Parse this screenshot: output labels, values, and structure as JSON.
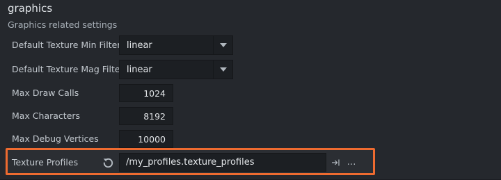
{
  "section": {
    "title": "graphics",
    "description": "Graphics related settings"
  },
  "settings": {
    "min_filter": {
      "label": "Default Texture Min Filter",
      "value": "linear"
    },
    "mag_filter": {
      "label": "Default Texture Mag Filter",
      "value": "linear"
    },
    "max_draw_calls": {
      "label": "Max Draw Calls",
      "value": "1024"
    },
    "max_characters": {
      "label": "Max Characters",
      "value": "8192"
    },
    "max_debug_vertices": {
      "label": "Max Debug Vertices",
      "value": "10000"
    },
    "texture_profiles": {
      "label": "Texture Profiles",
      "value": "/my_profiles.texture_profiles",
      "more_label": "…"
    }
  },
  "colors": {
    "highlight": "#ee6b30",
    "background": "#25282d",
    "field": "#1c1f23"
  },
  "icons": {
    "dropdown": "chevron-down-icon",
    "reset": "reset-icon",
    "jump": "jump-to-icon",
    "browse": "more-icon"
  }
}
